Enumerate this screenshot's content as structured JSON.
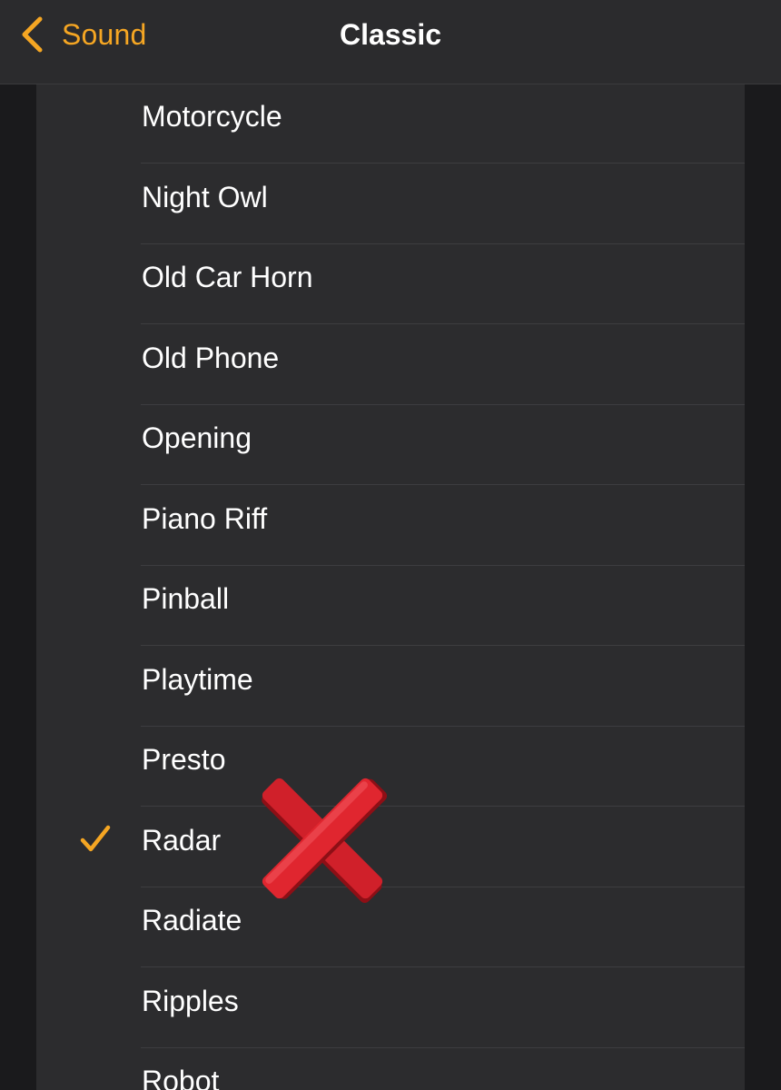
{
  "navbar": {
    "back_label": "Sound",
    "title": "Classic",
    "back_icon": "chevron-left-icon"
  },
  "colors": {
    "accent": "#f5a623",
    "list_background": "#2c2c2e",
    "navbar_background": "#2b2b2d",
    "text": "#ffffff",
    "separator": "#3d3d40",
    "overlay_mark": "#d0202a"
  },
  "sounds": [
    {
      "label": "Motorcycle",
      "selected": false
    },
    {
      "label": "Night Owl",
      "selected": false
    },
    {
      "label": "Old Car Horn",
      "selected": false
    },
    {
      "label": "Old Phone",
      "selected": false
    },
    {
      "label": "Opening",
      "selected": false
    },
    {
      "label": "Piano Riff",
      "selected": false
    },
    {
      "label": "Pinball",
      "selected": false
    },
    {
      "label": "Playtime",
      "selected": false
    },
    {
      "label": "Presto",
      "selected": false
    },
    {
      "label": "Radar",
      "selected": true
    },
    {
      "label": "Radiate",
      "selected": false
    },
    {
      "label": "Ripples",
      "selected": false
    },
    {
      "label": "Robot",
      "selected": false
    }
  ],
  "overlay": {
    "icon": "red-x-mark-icon"
  }
}
